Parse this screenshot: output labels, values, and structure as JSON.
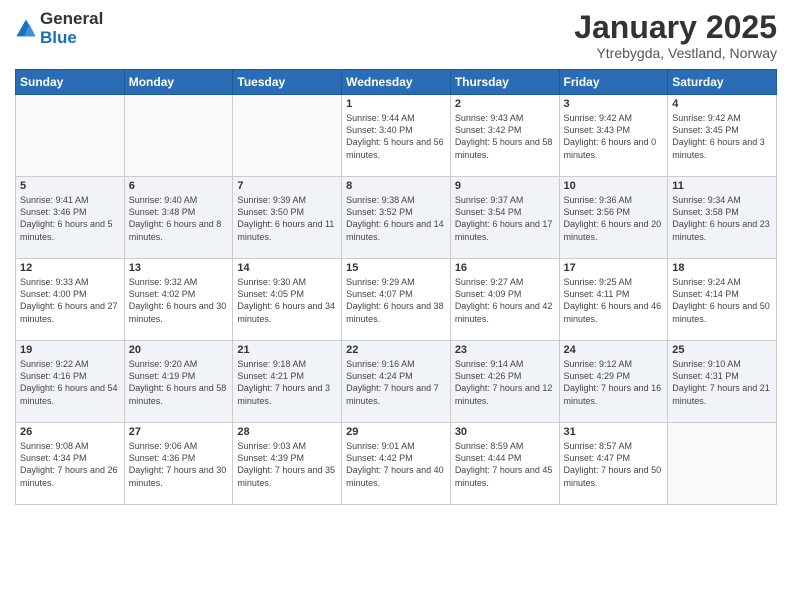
{
  "logo": {
    "general": "General",
    "blue": "Blue"
  },
  "title": "January 2025",
  "subtitle": "Ytrebygda, Vestland, Norway",
  "days_of_week": [
    "Sunday",
    "Monday",
    "Tuesday",
    "Wednesday",
    "Thursday",
    "Friday",
    "Saturday"
  ],
  "weeks": [
    [
      {
        "day": "",
        "info": ""
      },
      {
        "day": "",
        "info": ""
      },
      {
        "day": "",
        "info": ""
      },
      {
        "day": "1",
        "info": "Sunrise: 9:44 AM\nSunset: 3:40 PM\nDaylight: 5 hours and 56 minutes."
      },
      {
        "day": "2",
        "info": "Sunrise: 9:43 AM\nSunset: 3:42 PM\nDaylight: 5 hours and 58 minutes."
      },
      {
        "day": "3",
        "info": "Sunrise: 9:42 AM\nSunset: 3:43 PM\nDaylight: 6 hours and 0 minutes."
      },
      {
        "day": "4",
        "info": "Sunrise: 9:42 AM\nSunset: 3:45 PM\nDaylight: 6 hours and 3 minutes."
      }
    ],
    [
      {
        "day": "5",
        "info": "Sunrise: 9:41 AM\nSunset: 3:46 PM\nDaylight: 6 hours and 5 minutes."
      },
      {
        "day": "6",
        "info": "Sunrise: 9:40 AM\nSunset: 3:48 PM\nDaylight: 6 hours and 8 minutes."
      },
      {
        "day": "7",
        "info": "Sunrise: 9:39 AM\nSunset: 3:50 PM\nDaylight: 6 hours and 11 minutes."
      },
      {
        "day": "8",
        "info": "Sunrise: 9:38 AM\nSunset: 3:52 PM\nDaylight: 6 hours and 14 minutes."
      },
      {
        "day": "9",
        "info": "Sunrise: 9:37 AM\nSunset: 3:54 PM\nDaylight: 6 hours and 17 minutes."
      },
      {
        "day": "10",
        "info": "Sunrise: 9:36 AM\nSunset: 3:56 PM\nDaylight: 6 hours and 20 minutes."
      },
      {
        "day": "11",
        "info": "Sunrise: 9:34 AM\nSunset: 3:58 PM\nDaylight: 6 hours and 23 minutes."
      }
    ],
    [
      {
        "day": "12",
        "info": "Sunrise: 9:33 AM\nSunset: 4:00 PM\nDaylight: 6 hours and 27 minutes."
      },
      {
        "day": "13",
        "info": "Sunrise: 9:32 AM\nSunset: 4:02 PM\nDaylight: 6 hours and 30 minutes."
      },
      {
        "day": "14",
        "info": "Sunrise: 9:30 AM\nSunset: 4:05 PM\nDaylight: 6 hours and 34 minutes."
      },
      {
        "day": "15",
        "info": "Sunrise: 9:29 AM\nSunset: 4:07 PM\nDaylight: 6 hours and 38 minutes."
      },
      {
        "day": "16",
        "info": "Sunrise: 9:27 AM\nSunset: 4:09 PM\nDaylight: 6 hours and 42 minutes."
      },
      {
        "day": "17",
        "info": "Sunrise: 9:25 AM\nSunset: 4:11 PM\nDaylight: 6 hours and 46 minutes."
      },
      {
        "day": "18",
        "info": "Sunrise: 9:24 AM\nSunset: 4:14 PM\nDaylight: 6 hours and 50 minutes."
      }
    ],
    [
      {
        "day": "19",
        "info": "Sunrise: 9:22 AM\nSunset: 4:16 PM\nDaylight: 6 hours and 54 minutes."
      },
      {
        "day": "20",
        "info": "Sunrise: 9:20 AM\nSunset: 4:19 PM\nDaylight: 6 hours and 58 minutes."
      },
      {
        "day": "21",
        "info": "Sunrise: 9:18 AM\nSunset: 4:21 PM\nDaylight: 7 hours and 3 minutes."
      },
      {
        "day": "22",
        "info": "Sunrise: 9:16 AM\nSunset: 4:24 PM\nDaylight: 7 hours and 7 minutes."
      },
      {
        "day": "23",
        "info": "Sunrise: 9:14 AM\nSunset: 4:26 PM\nDaylight: 7 hours and 12 minutes."
      },
      {
        "day": "24",
        "info": "Sunrise: 9:12 AM\nSunset: 4:29 PM\nDaylight: 7 hours and 16 minutes."
      },
      {
        "day": "25",
        "info": "Sunrise: 9:10 AM\nSunset: 4:31 PM\nDaylight: 7 hours and 21 minutes."
      }
    ],
    [
      {
        "day": "26",
        "info": "Sunrise: 9:08 AM\nSunset: 4:34 PM\nDaylight: 7 hours and 26 minutes."
      },
      {
        "day": "27",
        "info": "Sunrise: 9:06 AM\nSunset: 4:36 PM\nDaylight: 7 hours and 30 minutes."
      },
      {
        "day": "28",
        "info": "Sunrise: 9:03 AM\nSunset: 4:39 PM\nDaylight: 7 hours and 35 minutes."
      },
      {
        "day": "29",
        "info": "Sunrise: 9:01 AM\nSunset: 4:42 PM\nDaylight: 7 hours and 40 minutes."
      },
      {
        "day": "30",
        "info": "Sunrise: 8:59 AM\nSunset: 4:44 PM\nDaylight: 7 hours and 45 minutes."
      },
      {
        "day": "31",
        "info": "Sunrise: 8:57 AM\nSunset: 4:47 PM\nDaylight: 7 hours and 50 minutes."
      },
      {
        "day": "",
        "info": ""
      }
    ]
  ]
}
